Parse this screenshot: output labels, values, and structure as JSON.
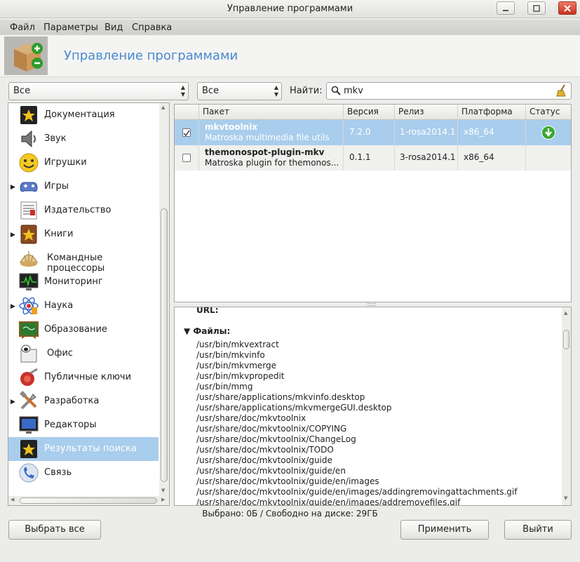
{
  "window": {
    "title": "Управление программами"
  },
  "menu": [
    "Файл",
    "Параметры",
    "Вид",
    "Справка"
  ],
  "header": {
    "title": "Управление программами"
  },
  "filters": {
    "group": "Все",
    "type": "Все",
    "find_label": "Найти:",
    "search_value": "mkv"
  },
  "categories": [
    {
      "label": "Документация",
      "icon": "document-star-icon",
      "expandable": false,
      "selected": false
    },
    {
      "label": "Звук",
      "icon": "speaker-icon",
      "expandable": false,
      "selected": false
    },
    {
      "label": "Игрушки",
      "icon": "smiley-icon",
      "expandable": false,
      "selected": false
    },
    {
      "label": "Игры",
      "icon": "gamepad-icon",
      "expandable": true,
      "selected": false
    },
    {
      "label": "Издательство",
      "icon": "publishing-icon",
      "expandable": false,
      "selected": false
    },
    {
      "label": "Книги",
      "icon": "book-star-icon",
      "expandable": true,
      "selected": false
    },
    {
      "label": "Командные процессоры",
      "icon": "shell-icon",
      "expandable": false,
      "selected": false
    },
    {
      "label": "Мониторинг",
      "icon": "monitor-graph-icon",
      "expandable": false,
      "selected": false
    },
    {
      "label": "Наука",
      "icon": "atom-icon",
      "expandable": true,
      "selected": false
    },
    {
      "label": "Образование",
      "icon": "chalkboard-icon",
      "expandable": false,
      "selected": false
    },
    {
      "label": "Офис",
      "icon": "office-icon",
      "expandable": false,
      "selected": false
    },
    {
      "label": "Публичные ключи",
      "icon": "key-seal-icon",
      "expandable": false,
      "selected": false
    },
    {
      "label": "Разработка",
      "icon": "tools-icon",
      "expandable": true,
      "selected": false
    },
    {
      "label": "Редакторы",
      "icon": "monitor-icon",
      "expandable": false,
      "selected": false
    },
    {
      "label": "Результаты поиска",
      "icon": "search-results-star-icon",
      "expandable": false,
      "selected": true
    },
    {
      "label": "Связь",
      "icon": "phone-icon",
      "expandable": false,
      "selected": false
    }
  ],
  "table": {
    "headers": [
      "Пакет",
      "Версия",
      "Релиз",
      "Платформа",
      "Статус"
    ],
    "rows": [
      {
        "name": "mkvtoolnix",
        "desc": "Matroska multimedia file utils",
        "version": "7.2.0",
        "release": "1-rosa2014.1",
        "platform": "x86_64",
        "checked": true,
        "status": "installed-download-icon",
        "selected": true
      },
      {
        "name": "themonospot-plugin-mkv",
        "desc": "Matroska plugin for themonos...",
        "version": "0.1.1",
        "release": "3-rosa2014.1",
        "platform": "x86_64",
        "checked": false,
        "status": "",
        "selected": false
      }
    ]
  },
  "details": {
    "url_label": "URL:",
    "files_label": "Файлы:",
    "files": [
      "/usr/bin/mkvextract",
      "/usr/bin/mkvinfo",
      "/usr/bin/mkvmerge",
      "/usr/bin/mkvpropedit",
      "/usr/bin/mmg",
      "/usr/share/applications/mkvinfo.desktop",
      "/usr/share/applications/mkvmergeGUI.desktop",
      "/usr/share/doc/mkvtoolnix",
      "/usr/share/doc/mkvtoolnix/COPYING",
      "/usr/share/doc/mkvtoolnix/ChangeLog",
      "/usr/share/doc/mkvtoolnix/TODO",
      "/usr/share/doc/mkvtoolnix/guide",
      "/usr/share/doc/mkvtoolnix/guide/en",
      "/usr/share/doc/mkvtoolnix/guide/en/images",
      "/usr/share/doc/mkvtoolnix/guide/en/images/addingremovingattachments.gif",
      "/usr/share/doc/mkvtoolnix/guide/en/images/addremovefiles.gif"
    ]
  },
  "status_text": "Выбрано: 0Б / Свободно на диске: 29ГБ",
  "buttons": {
    "select_all": "Выбрать все",
    "apply": "Применить",
    "exit": "Выйти"
  },
  "colors": {
    "selection": "#a9cdec",
    "header_title": "#4a8ad0",
    "status_green": "#3ca832"
  }
}
